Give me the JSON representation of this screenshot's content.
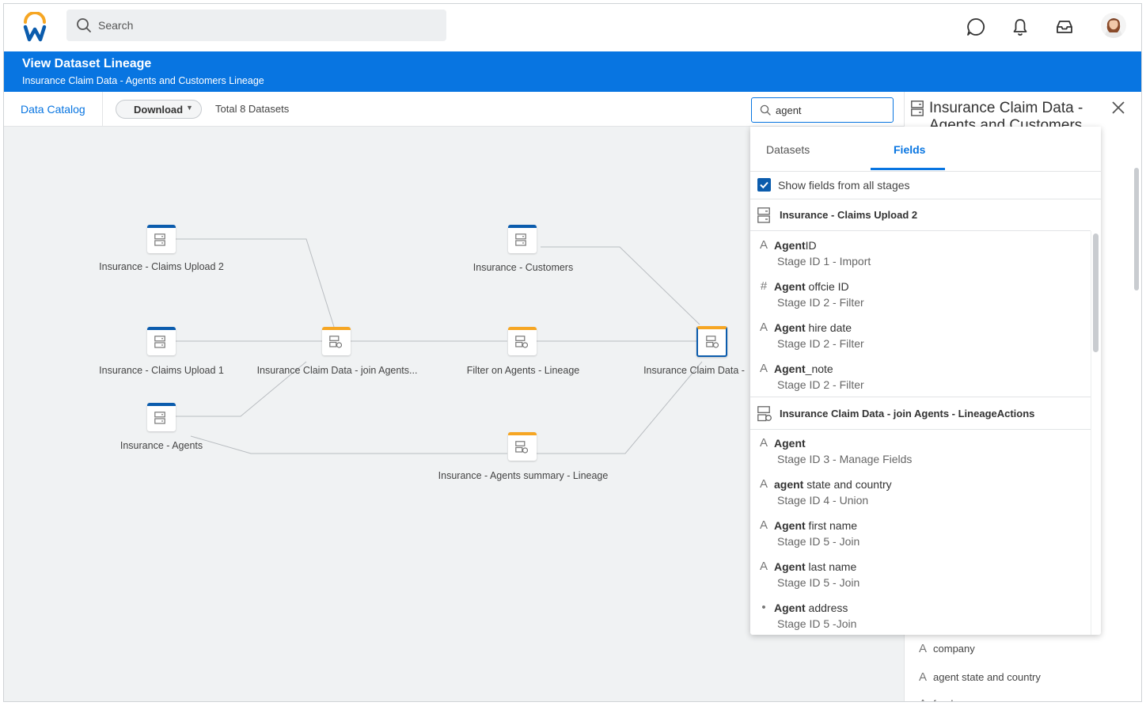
{
  "topbar": {
    "search_placeholder": "Search"
  },
  "header": {
    "title": "View Dataset Lineage",
    "subtitle": "Insurance Claim Data -  Agents and Customers Lineage"
  },
  "toolbar": {
    "breadcrumb": "Data Catalog",
    "download_label": "Download",
    "download_caret": "▼",
    "total_label": "Total 8 Datasets"
  },
  "nodes": [
    {
      "label": "Insurance - Claims Upload 2"
    },
    {
      "label": "Insurance - Claims Upload 1"
    },
    {
      "label": "Insurance - Agents"
    },
    {
      "label": "Insurance Claim Data -  join Agents..."
    },
    {
      "label": "Insurance - Customers"
    },
    {
      "label": "Filter on Agents - Lineage"
    },
    {
      "label": "Insurance - Agents summary - Lineage"
    },
    {
      "label": "Insurance Claim Data -"
    }
  ],
  "field_search": {
    "value": "agent"
  },
  "dropdown": {
    "tabs": [
      {
        "label": "Datasets",
        "active": false
      },
      {
        "label": "Fields",
        "active": true
      }
    ],
    "show_all_label": "Show fields from all stages",
    "show_all_checked": true,
    "groups": [
      {
        "title": "Insurance - Claims Upload 2",
        "fields": [
          {
            "icon": "A",
            "match": "Agent",
            "rest": "ID",
            "stage": "Stage ID 1 -  Import"
          },
          {
            "icon": "#",
            "match": "Agent",
            "rest": " offcie ID",
            "stage": "Stage ID 2 - Filter"
          },
          {
            "icon": "A",
            "match": "Agent",
            "rest": " hire date",
            "stage": "Stage ID 2 - Filter"
          },
          {
            "icon": "A",
            "match": "Agent",
            "rest": "_note",
            "stage": "Stage ID 2 - Filter"
          }
        ]
      },
      {
        "title": "Insurance Claim Data - join Agents - LineageActions",
        "fields": [
          {
            "icon": "A",
            "match": "Agent",
            "rest": "",
            "stage": "Stage ID 3 - Manage Fields"
          },
          {
            "icon": "A",
            "match": "agent",
            "rest": " state and country",
            "stage": "Stage ID 4 - Union"
          },
          {
            "icon": "A",
            "match": "Agent",
            "rest": " first name",
            "stage": "Stage ID 5 - Join"
          },
          {
            "icon": "A",
            "match": "Agent",
            "rest": " last name",
            "stage": "Stage ID 5 - Join"
          },
          {
            "icon": "•",
            "match": "Agent",
            "rest": " address",
            "stage": "Stage ID 5 -Join"
          }
        ]
      }
    ]
  },
  "right_panel": {
    "title": "Insurance Claim Data - Agents and Customers",
    "fields": [
      {
        "icon": "A",
        "label": "company"
      },
      {
        "icon": "A",
        "label": "agent state and country"
      },
      {
        "icon": "A",
        "label": "fund"
      }
    ]
  },
  "colors": {
    "brand_blue": "#0875e1",
    "node_blue": "#0b5cad",
    "node_orange": "#f6a623",
    "logo_orange": "#f6a623"
  }
}
